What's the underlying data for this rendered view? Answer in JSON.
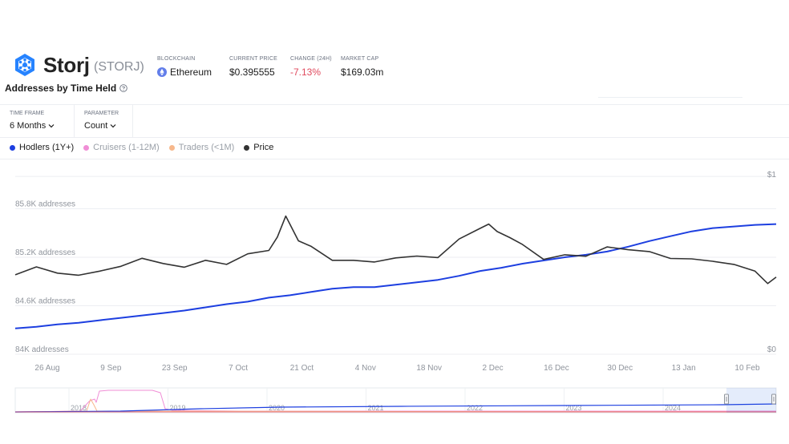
{
  "token": {
    "name": "Storj",
    "ticker": "(STORJ)",
    "blockchain_label": "BLOCKCHAIN",
    "blockchain_value": "Ethereum",
    "price_label": "CURRENT PRICE",
    "price_value": "$0.395555",
    "change_label": "CHANGE (24H)",
    "change_value": "-7.13%",
    "mcap_label": "MARKET CAP",
    "mcap_value": "$169.03m"
  },
  "section": {
    "title": "Addresses by Time Held"
  },
  "controls": {
    "timeframe_label": "TIME FRAME",
    "timeframe_value": "6 Months",
    "parameter_label": "PARAMETER",
    "parameter_value": "Count"
  },
  "legend": [
    {
      "label": "Hodlers (1Y+)",
      "color": "#1d3fe0",
      "active": true
    },
    {
      "label": "Cruisers (1-12M)",
      "color": "#f08ed6",
      "active": false
    },
    {
      "label": "Traders (<1M)",
      "color": "#f7b88c",
      "active": false
    },
    {
      "label": "Price",
      "color": "#333333",
      "active": true
    }
  ],
  "colors": {
    "accent": "#1d3fe0",
    "negative": "#e0495d",
    "price": "#333333"
  },
  "chart_data": {
    "type": "line",
    "y_left": {
      "ticks": [
        84000,
        84600,
        85200,
        85800
      ],
      "tick_labels": [
        "84K addresses",
        "84.6K addresses",
        "85.2K addresses",
        "85.8K addresses"
      ],
      "range": [
        84000,
        86300
      ]
    },
    "y_right": {
      "ticks": [
        0,
        1
      ],
      "tick_labels": [
        "$0",
        "$1"
      ],
      "range": [
        0,
        1
      ]
    },
    "x_labels": [
      "26 Aug",
      "9 Sep",
      "23 Sep",
      "7 Oct",
      "21 Oct",
      "4 Nov",
      "18 Nov",
      "2 Dec",
      "16 Dec",
      "30 Dec",
      "13 Jan",
      "10 Feb"
    ],
    "grid": true,
    "series": [
      {
        "name": "Hodlers (1Y+)",
        "axis": "left",
        "x": [
          0,
          5,
          10,
          15,
          20,
          25,
          30,
          35,
          40,
          45,
          50,
          55,
          60,
          65,
          70,
          75,
          80,
          85,
          90,
          95,
          100,
          105,
          110,
          115,
          120,
          125,
          130,
          135,
          140,
          145,
          150,
          155,
          160,
          165,
          170,
          175,
          180
        ],
        "values": [
          84320,
          84340,
          84370,
          84390,
          84420,
          84450,
          84480,
          84510,
          84540,
          84580,
          84620,
          84650,
          84700,
          84730,
          84770,
          84810,
          84830,
          84830,
          84860,
          84890,
          84920,
          84970,
          85030,
          85070,
          85120,
          85160,
          85200,
          85230,
          85270,
          85330,
          85400,
          85460,
          85520,
          85560,
          85580,
          85600,
          85610
        ]
      },
      {
        "name": "Price",
        "axis": "right",
        "x": [
          0,
          5,
          10,
          15,
          20,
          25,
          30,
          35,
          40,
          45,
          50,
          55,
          60,
          62,
          64,
          67,
          70,
          75,
          80,
          85,
          90,
          95,
          100,
          105,
          110,
          112,
          114,
          117,
          120,
          125,
          130,
          135,
          140,
          145,
          150,
          155,
          160,
          165,
          170,
          175,
          178,
          180
        ],
        "values": [
          0.427,
          0.47,
          0.436,
          0.425,
          0.447,
          0.473,
          0.516,
          0.488,
          0.468,
          0.505,
          0.483,
          0.54,
          0.558,
          0.63,
          0.743,
          0.61,
          0.58,
          0.505,
          0.505,
          0.496,
          0.518,
          0.528,
          0.52,
          0.62,
          0.677,
          0.7,
          0.66,
          0.627,
          0.59,
          0.51,
          0.535,
          0.527,
          0.577,
          0.562,
          0.552,
          0.515,
          0.513,
          0.5,
          0.483,
          0.447,
          0.38,
          0.415
        ]
      }
    ],
    "navigator": {
      "year_labels": [
        "2018",
        "2019",
        "2020",
        "2021",
        "2022",
        "2023",
        "2024"
      ]
    }
  }
}
